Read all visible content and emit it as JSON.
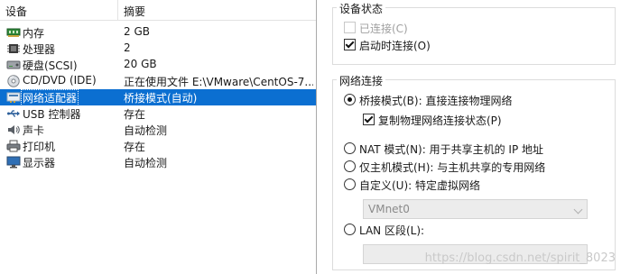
{
  "device_list": {
    "columns": {
      "device": "设备",
      "summary": "摘要"
    },
    "rows": [
      {
        "icon": "memory-icon",
        "name": "内存",
        "summary": "2 GB"
      },
      {
        "icon": "cpu-icon",
        "name": "处理器",
        "summary": "2"
      },
      {
        "icon": "hard-disk-icon",
        "name": "硬盘(SCSI)",
        "summary": "20 GB"
      },
      {
        "icon": "cd-dvd-icon",
        "name": "CD/DVD (IDE)",
        "summary": "正在使用文件 E:\\VMware\\CentOS-7..."
      },
      {
        "icon": "network-adapter-icon",
        "name": "网络适配器",
        "summary": "桥接模式(自动)",
        "selected": true
      },
      {
        "icon": "usb-icon",
        "name": "USB 控制器",
        "summary": "存在"
      },
      {
        "icon": "sound-card-icon",
        "name": "声卡",
        "summary": "自动检测"
      },
      {
        "icon": "printer-icon",
        "name": "打印机",
        "summary": "存在"
      },
      {
        "icon": "display-icon",
        "name": "显示器",
        "summary": "自动检测"
      }
    ],
    "selected_color": "#0b6fd1"
  },
  "device_status": {
    "title": "设备状态",
    "connected": {
      "label": "已连接(C)",
      "checked": false,
      "enabled": false
    },
    "connect_at_power_on": {
      "label": "启动时连接(O)",
      "checked": true,
      "enabled": true
    }
  },
  "network_connection": {
    "title": "网络连接",
    "bridged": {
      "label": "桥接模式(B): 直接连接物理网络",
      "selected": true
    },
    "replicate_state": {
      "label": "复制物理网络连接状态(P)",
      "checked": true
    },
    "nat": {
      "label": "NAT 模式(N): 用于共享主机的 IP 地址",
      "selected": false
    },
    "host_only": {
      "label": "仅主机模式(H): 与主机共享的专用网络",
      "selected": false
    },
    "custom": {
      "label": "自定义(U): 特定虚拟网络",
      "selected": false
    },
    "custom_network": {
      "value": "VMnet0",
      "enabled": false
    },
    "lan_segment": {
      "label": "LAN 区段(L):",
      "selected": false,
      "enabled": false
    }
  },
  "watermark": "https://blog.csdn.net/spirit_8023"
}
